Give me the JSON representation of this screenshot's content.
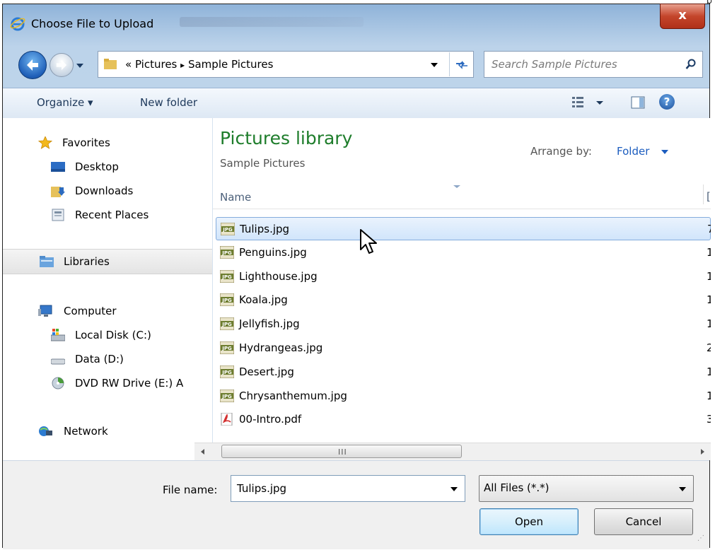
{
  "window": {
    "title": "Choose File to Upload",
    "close_label": "x",
    "edge_char": "p"
  },
  "address": {
    "path_prefix": "«",
    "crumbs": [
      "Pictures",
      "Sample Pictures"
    ],
    "separator": "▸"
  },
  "search": {
    "placeholder": "Search Sample Pictures"
  },
  "toolbar": {
    "organize_label": "Organize ▾",
    "new_folder_label": "New folder",
    "help_label": "?"
  },
  "navpane": {
    "favorites": "Favorites",
    "desktop": "Desktop",
    "downloads": "Downloads",
    "recent_places": "Recent Places",
    "libraries": "Libraries",
    "computer": "Computer",
    "local_disk": "Local Disk (C:)",
    "data_drive": "Data (D:)",
    "dvd_drive": "DVD RW Drive (E:) A",
    "network": "Network"
  },
  "content": {
    "library_title": "Pictures library",
    "library_subtitle": "Sample Pictures",
    "arrange_label": "Arrange by:",
    "arrange_value": "Folder",
    "column_name": "Name",
    "column_next_cut": "[",
    "files": [
      {
        "name": "Tulips.jpg",
        "type": "jpg",
        "cut": "7"
      },
      {
        "name": "Penguins.jpg",
        "type": "jpg",
        "cut": "1"
      },
      {
        "name": "Lighthouse.jpg",
        "type": "jpg",
        "cut": "1"
      },
      {
        "name": "Koala.jpg",
        "type": "jpg",
        "cut": "1"
      },
      {
        "name": "Jellyfish.jpg",
        "type": "jpg",
        "cut": "1"
      },
      {
        "name": "Hydrangeas.jpg",
        "type": "jpg",
        "cut": "2"
      },
      {
        "name": "Desert.jpg",
        "type": "jpg",
        "cut": "1"
      },
      {
        "name": "Chrysanthemum.jpg",
        "type": "jpg",
        "cut": "1"
      },
      {
        "name": "00-Intro.pdf",
        "type": "pdf",
        "cut": "3"
      }
    ],
    "selected_index": 0
  },
  "scrollbar": {
    "grip": "III"
  },
  "bottom": {
    "file_name_label": "File name:",
    "file_name_value": "Tulips.jpg",
    "file_type_value": "All Files (*.*)",
    "open_label": "Open",
    "cancel_label": "Cancel"
  },
  "colors": {
    "library_title": "#1e7d2b",
    "link_blue": "#1c5dbf",
    "selection_border": "#84acdd"
  }
}
